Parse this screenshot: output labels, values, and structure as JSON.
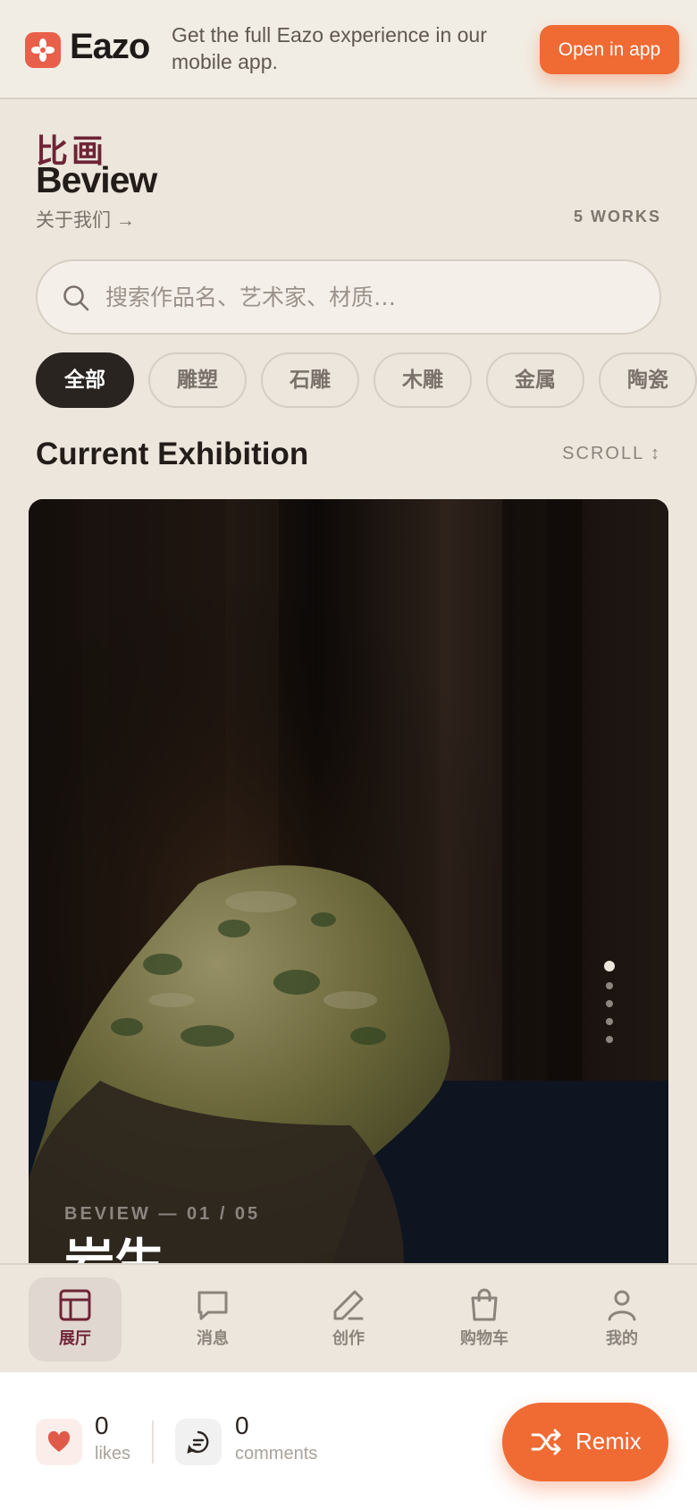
{
  "banner": {
    "brand": "Eazo",
    "message": "Get the full Eazo experience in our mobile app.",
    "open_label": "Open in app"
  },
  "header": {
    "title_zh": "比画",
    "title_en": "Beview",
    "about_link": "关于我们 →",
    "works_count": "5 WORKS"
  },
  "search": {
    "placeholder": "搜索作品名、艺术家、材质…",
    "value": ""
  },
  "categories": [
    {
      "label": "全部",
      "active": true
    },
    {
      "label": "雕塑",
      "active": false
    },
    {
      "label": "石雕",
      "active": false
    },
    {
      "label": "木雕",
      "active": false
    },
    {
      "label": "金属",
      "active": false
    },
    {
      "label": "陶瓷",
      "active": false
    }
  ],
  "section": {
    "title": "Current Exhibition",
    "scroll_hint": "SCROLL ↕"
  },
  "hero": {
    "meta": "BEVIEW — 01 / 05",
    "title": "岩生",
    "slide_index": 1,
    "slide_total": 5
  },
  "bottom_nav": [
    {
      "label": "展厅",
      "icon": "gallery-icon",
      "active": true
    },
    {
      "label": "消息",
      "icon": "message-icon",
      "active": false
    },
    {
      "label": "创作",
      "icon": "pen-icon",
      "active": false
    },
    {
      "label": "购物车",
      "icon": "bag-icon",
      "active": false
    },
    {
      "label": "我的",
      "icon": "user-icon",
      "active": false
    }
  ],
  "footer": {
    "likes_count": "0",
    "likes_label": "likes",
    "comments_count": "0",
    "comments_label": "comments",
    "remix_label": "Remix"
  },
  "colors": {
    "accent": "#f06a33",
    "brand_maroon": "#6e2436",
    "background": "#ece6dd"
  }
}
